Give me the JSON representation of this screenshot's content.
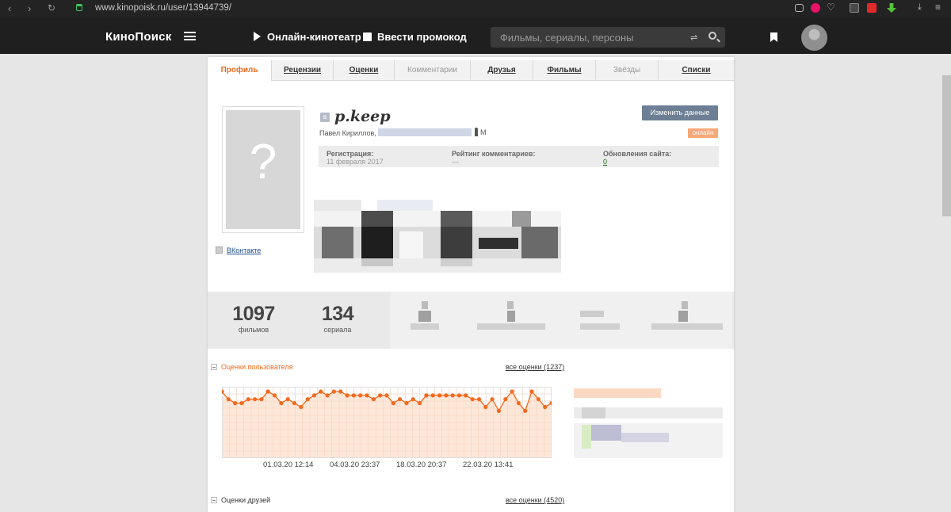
{
  "browser": {
    "url": "www.kinopoisk.ru/user/13944739/"
  },
  "header": {
    "logo": "КиноПоиск",
    "cinema": "Онлайн-кинотеатр",
    "promo": "Ввести промокод",
    "search_placeholder": "Фильмы, сериалы, персоны"
  },
  "tabs": [
    {
      "label": "Профиль",
      "state": "active"
    },
    {
      "label": "Рецензии",
      "state": "link"
    },
    {
      "label": "Оценки",
      "state": "link"
    },
    {
      "label": "Комментарии",
      "state": "disabled"
    },
    {
      "label": "Друзья",
      "state": "link"
    },
    {
      "label": "Фильмы",
      "state": "link"
    },
    {
      "label": "Звёзды",
      "state": "disabled"
    },
    {
      "label": "Списки",
      "state": "link"
    }
  ],
  "profile": {
    "nick": "p.keep",
    "vk_badge": "в",
    "real_name": "Павел Кириллов,",
    "gender": "М",
    "edit_button": "Изменить данные",
    "online_badge": "онлайн",
    "photo_placeholder": "?",
    "vk_link": "ВКонтакте",
    "info": {
      "reg_label": "Регистрация:",
      "reg_value": "11 февраля 2017",
      "rating_label": "Рейтинг комментариев:",
      "rating_value": "—",
      "updates_label": "Обновления сайта:",
      "updates_value": "0"
    }
  },
  "stats": {
    "films_count": "1097",
    "films_label": "фильмов",
    "series_count": "134",
    "series_label": "сериала"
  },
  "user_ratings": {
    "title": "Оценки пользователя",
    "all_link": "все оценки (1237)"
  },
  "friends_ratings": {
    "title": "Оценки друзей",
    "all_link": "все оценки (4520)"
  },
  "chart_data": {
    "type": "line",
    "x_tick_labels": [
      "01.03.20 12:14",
      "04.03.20 23:37",
      "18.03.20 20:37",
      "22.03.20 13:41"
    ],
    "ylim": [
      0,
      10
    ],
    "grid": true,
    "color": "#f26a1d",
    "fill_color": "#fde3d2",
    "values": [
      10,
      8,
      7,
      7,
      8,
      8,
      8,
      10,
      9,
      7,
      8,
      7,
      6,
      8,
      9,
      10,
      9,
      10,
      10,
      9,
      9,
      9,
      9,
      8,
      9,
      9,
      7,
      8,
      7,
      8,
      7,
      9,
      9,
      9,
      9,
      9,
      9,
      9,
      8,
      8,
      6,
      8,
      5,
      8,
      10,
      7,
      5,
      10,
      8,
      6,
      7
    ]
  },
  "colors": {
    "accent": "#f26a1d",
    "header_bg": "#1f1f1f",
    "button": "#6c7f94",
    "online": "#f8a97a"
  }
}
